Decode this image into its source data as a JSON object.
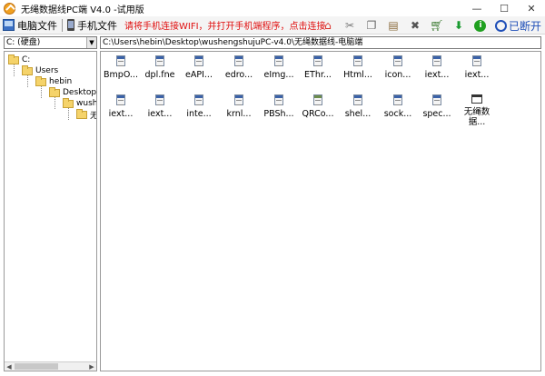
{
  "window": {
    "title": "无绳数据线PC端 V4.0 -试用版",
    "controls": {
      "minimize": "—",
      "maximize": "☐",
      "close": "✕"
    }
  },
  "toolbar": {
    "tab_pc": "电脑文件",
    "tab_phone": "手机文件",
    "notice": "请将手机连接WIFI，并打开手机端程序，点击连接",
    "disconnect": "已断开",
    "icons": [
      "home-icon",
      "cut-icon",
      "copy-icon",
      "paste-icon",
      "delete-icon",
      "cart-icon",
      "download-icon",
      "info-icon"
    ]
  },
  "address": {
    "drive": "C:  (硬盘)",
    "path": "C:\\Users\\hebin\\Desktop\\wushengshujuPC-v4.0\\无绳数据线-电脑端"
  },
  "tree": [
    {
      "label": "C:"
    },
    {
      "label": "Users"
    },
    {
      "label": "hebin"
    },
    {
      "label": "Desktop"
    },
    {
      "label": "wushen"
    },
    {
      "label": "无纟"
    }
  ],
  "files": [
    {
      "label": "BmpO...",
      "icon": "doc"
    },
    {
      "label": "dpl.fne",
      "icon": "doc"
    },
    {
      "label": "eAPI...",
      "icon": "doc"
    },
    {
      "label": "edro...",
      "icon": "doc"
    },
    {
      "label": "eImg...",
      "icon": "doc"
    },
    {
      "label": "EThr...",
      "icon": "doc"
    },
    {
      "label": "Html...",
      "icon": "doc"
    },
    {
      "label": "icon...",
      "icon": "doc"
    },
    {
      "label": "iext...",
      "icon": "doc"
    },
    {
      "label": "iext...",
      "icon": "doc"
    },
    {
      "label": "iext...",
      "icon": "doc"
    },
    {
      "label": "iext...",
      "icon": "doc"
    },
    {
      "label": "inte...",
      "icon": "doc"
    },
    {
      "label": "krnl...",
      "icon": "doc"
    },
    {
      "label": "PBSh...",
      "icon": "doc"
    },
    {
      "label": "QRCo...",
      "icon": "img"
    },
    {
      "label": "shel...",
      "icon": "doc"
    },
    {
      "label": "sock...",
      "icon": "doc"
    },
    {
      "label": "spec...",
      "icon": "doc"
    },
    {
      "label": "无绳数\n据...",
      "icon": "app"
    }
  ]
}
